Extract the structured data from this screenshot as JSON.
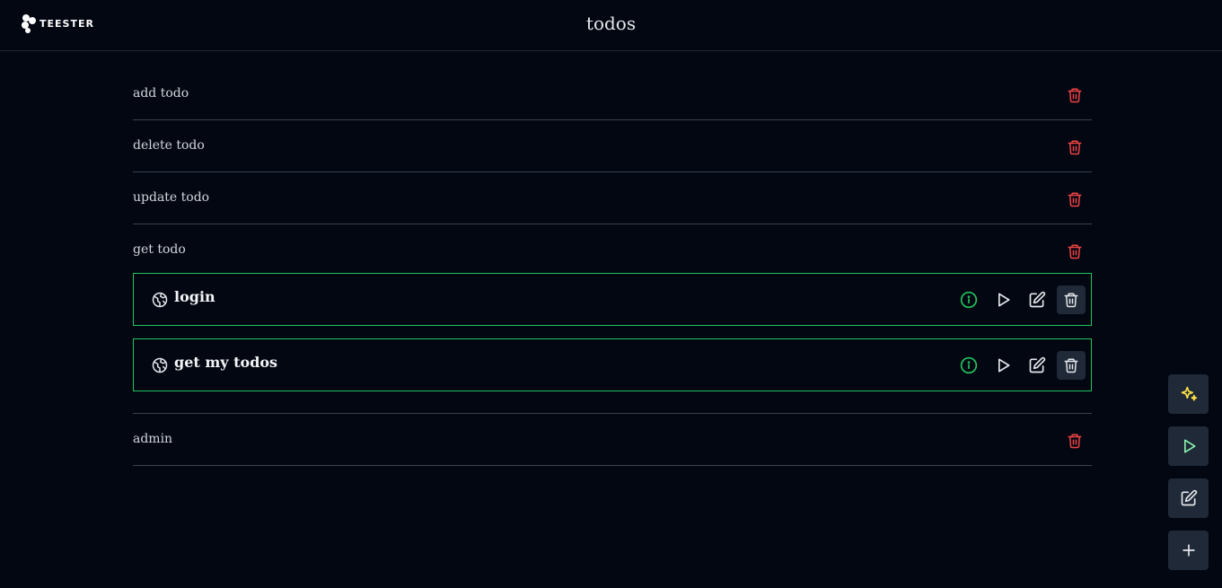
{
  "header": {
    "logo_text": "TEESTER",
    "title": "todos"
  },
  "groups_top": [
    {
      "label": "add todo"
    },
    {
      "label": "delete todo"
    },
    {
      "label": "update todo"
    },
    {
      "label": "get todo"
    }
  ],
  "tests": [
    {
      "label": "login"
    },
    {
      "label": "get my todos"
    }
  ],
  "groups_bottom": [
    {
      "label": "admin"
    }
  ],
  "fab": {
    "icons": [
      "sparkles-icon",
      "play-icon",
      "edit-icon",
      "plus-icon"
    ]
  },
  "colors": {
    "background": "#030712",
    "danger": "#ef4444",
    "success": "#22c55e",
    "fab_bg": "#1f2937",
    "sparkle": "#fde047",
    "play_fab": "#86efac"
  }
}
